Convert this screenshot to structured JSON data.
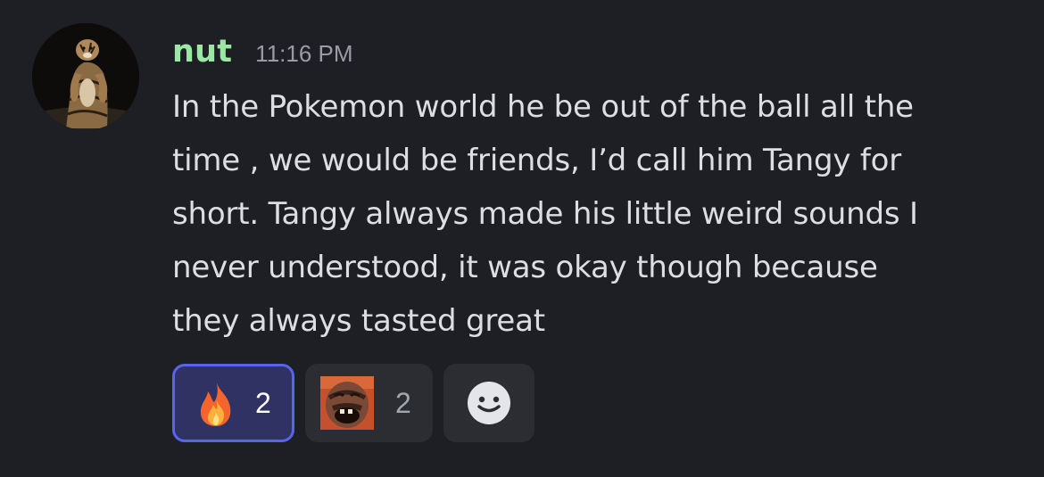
{
  "message": {
    "username": "nut",
    "timestamp": "11:16 PM",
    "content_lines": [
      "In the Pokemon world he be out of the ball all the",
      "time , we would be friends, I’d call him Tangy for",
      "short. Tangy always made his little weird sounds I",
      "never understood, it was okay though because",
      "they always tasted great"
    ],
    "username_color": "#9ae8a4"
  },
  "reactions": [
    {
      "emoji": "fire-icon",
      "count": "2",
      "active": true
    },
    {
      "emoji": "laughing-man-custom-emoji",
      "count": "2",
      "active": false
    },
    {
      "emoji": "add-reaction-smiley-icon",
      "count": "",
      "active": false
    }
  ],
  "colors": {
    "background": "#1e1f24",
    "text": "#dddee1",
    "active_reaction_border": "#5965e8",
    "active_reaction_bg": "#2f3262",
    "reaction_bg": "#2b2d33"
  }
}
